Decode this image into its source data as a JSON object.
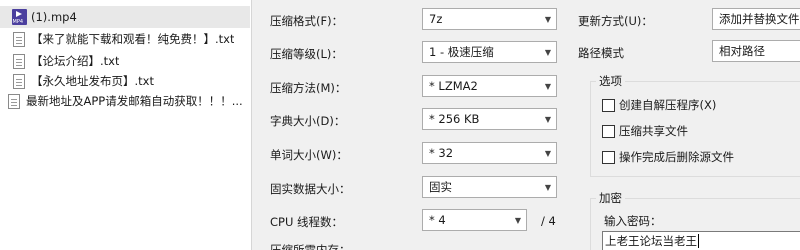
{
  "files": [
    {
      "name": "(1).mp4",
      "icon": "mp4-file-icon",
      "selected": true
    },
    {
      "name": "【来了就能下载和观看！纯免费！】.txt",
      "icon": "txt-file-icon",
      "selected": false
    },
    {
      "name": "【论坛介绍】.txt",
      "icon": "txt-file-icon",
      "selected": false
    },
    {
      "name": "【永久地址发布页】.txt",
      "icon": "txt-file-icon",
      "selected": false
    },
    {
      "name": "最新地址及APP请发邮箱自动获取！！！...",
      "icon": "txt-file-icon",
      "selected": false
    }
  ],
  "options": {
    "format_label": "压缩格式(F)：",
    "format_value": "7z",
    "level_label": "压缩等级(L)：",
    "level_value": "1 - 极速压缩",
    "method_label": "压缩方法(M)：",
    "method_value": "* LZMA2",
    "dict_label": "字典大小(D)：",
    "dict_value": "* 256 KB",
    "word_label": "单词大小(W)：",
    "word_value": "* 32",
    "solid_label": "固实数据大小：",
    "solid_value": "固实",
    "cpu_label": "CPU 线程数：",
    "cpu_value": "* 4",
    "cpu_total": "/ 4",
    "mem_label": "压缩所需内存："
  },
  "right": {
    "update_label": "更新方式(U)：",
    "update_value": "添加并替换文件",
    "path_label": "路径模式",
    "path_value": "相对路径",
    "options_group": "选项",
    "opt_sfx": "创建自解压程序(X)",
    "opt_shared": "压缩共享文件",
    "opt_delete": "操作完成后删除源文件",
    "encrypt_group": "加密",
    "password_label": "输入密码：",
    "password_value": "上老王论坛当老王"
  }
}
